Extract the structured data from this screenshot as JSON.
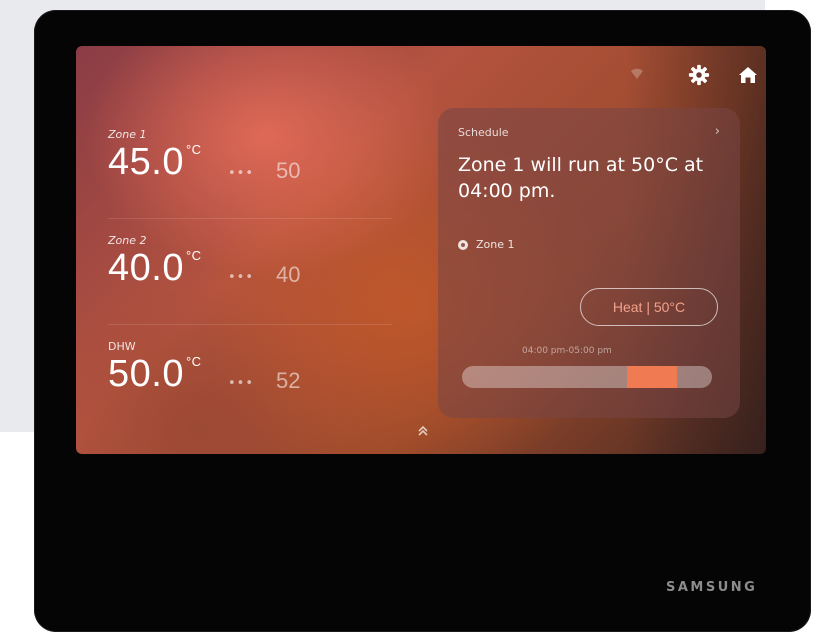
{
  "zones": [
    {
      "label": "Zone 1",
      "temp": "45.0",
      "unit": "°C",
      "dots": "•••",
      "target": "50"
    },
    {
      "label": "Zone 2",
      "temp": "40.0",
      "unit": "°C",
      "dots": "•••",
      "target": "40"
    },
    {
      "label": "DHW",
      "temp": "50.0",
      "unit": "°C",
      "dots": "•••",
      "target": "52"
    }
  ],
  "schedule": {
    "title": "Schedule",
    "chevron": "›",
    "message": "Zone 1 will run at 50°C at 04:00 pm.",
    "zone": "Zone 1",
    "mode_button": "Heat | 50°C",
    "time_range": "04:00 pm-05:00 pm",
    "progress_start_fraction": 0.66,
    "progress_end_fraction": 0.86
  },
  "icons": {
    "wifi": "wifi-icon",
    "settings": "gear-icon",
    "home": "home-icon",
    "expand": "chevron-up-icon"
  },
  "colors": {
    "accent": "#f07a52",
    "button_text": "#f3a18a",
    "device_body": "#050505"
  },
  "brand": "SAMSUNG"
}
